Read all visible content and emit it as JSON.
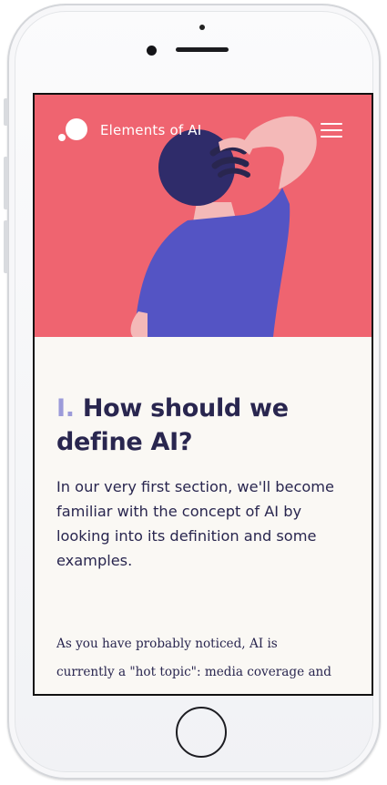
{
  "header": {
    "site_name": "Elements of AI",
    "logo_icon": "dots-logo-icon",
    "menu_icon": "hamburger-menu-icon"
  },
  "hero": {
    "illustration": "person-scratching-head",
    "background_color": "#ef6470"
  },
  "section": {
    "number": "I.",
    "title": "How should we define AI?",
    "intro": "In our very first section, we'll become familiar with the concept of AI by looking into its definition and some examples.",
    "body_lines": [
      "As you have probably noticed, AI is",
      "currently a \"hot topic\": media coverage and"
    ]
  },
  "colors": {
    "heading": "#29264f",
    "section_number": "#9c9bd9",
    "page_background": "#faf8f4"
  }
}
